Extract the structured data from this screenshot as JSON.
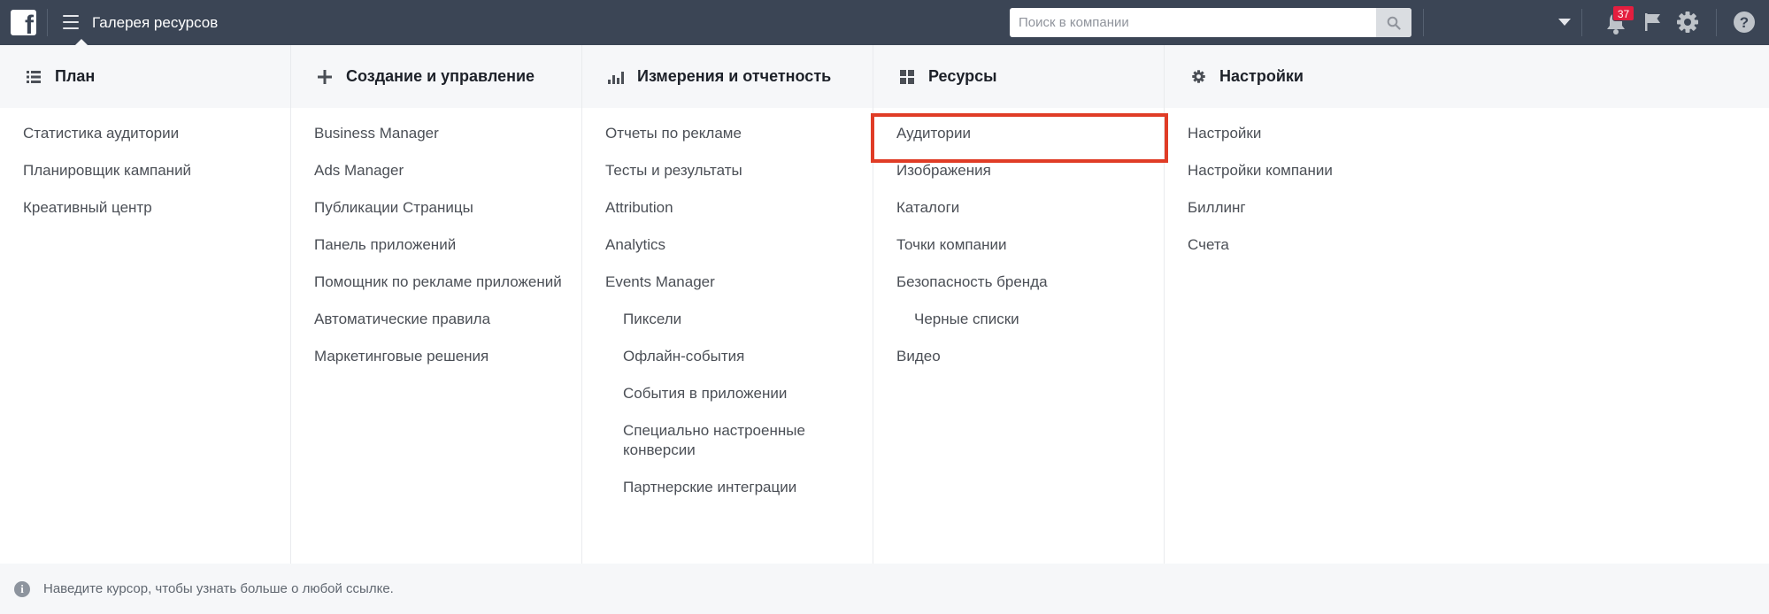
{
  "topbar": {
    "logo": "f",
    "title": "Галерея ресурсов",
    "search_placeholder": "Поиск в компании",
    "notifications_count": "37",
    "colors": {
      "bar": "#3b4555",
      "badge": "#e41e3f"
    }
  },
  "columns": [
    {
      "icon": "list-icon",
      "title": "План",
      "items": [
        {
          "label": "Статистика аудитории",
          "sub": false
        },
        {
          "label": "Планировщик кампаний",
          "sub": false
        },
        {
          "label": "Креативный центр",
          "sub": false
        }
      ]
    },
    {
      "icon": "plus-icon",
      "title": "Создание и управление",
      "items": [
        {
          "label": "Business Manager",
          "sub": false
        },
        {
          "label": "Ads Manager",
          "sub": false
        },
        {
          "label": "Публикации Страницы",
          "sub": false
        },
        {
          "label": "Панель приложений",
          "sub": false
        },
        {
          "label": "Помощник по рекламе приложений",
          "sub": false
        },
        {
          "label": "Автоматические правила",
          "sub": false
        },
        {
          "label": "Маркетинговые решения",
          "sub": false
        }
      ]
    },
    {
      "icon": "bar-chart-icon",
      "title": "Измерения и отчетность",
      "items": [
        {
          "label": "Отчеты по рекламе",
          "sub": false
        },
        {
          "label": "Тесты и результаты",
          "sub": false
        },
        {
          "label": "Attribution",
          "sub": false
        },
        {
          "label": "Analytics",
          "sub": false
        },
        {
          "label": "Events Manager",
          "sub": false
        },
        {
          "label": "Пиксели",
          "sub": true
        },
        {
          "label": "Офлайн-события",
          "sub": true
        },
        {
          "label": "События в приложении",
          "sub": true
        },
        {
          "label": "Специально настроенные конверсии",
          "sub": true
        },
        {
          "label": "Партнерские интеграции",
          "sub": true
        }
      ]
    },
    {
      "icon": "grid-icon",
      "title": "Ресурсы",
      "items": [
        {
          "label": "Аудитории",
          "sub": false
        },
        {
          "label": "Изображения",
          "sub": false
        },
        {
          "label": "Каталоги",
          "sub": false
        },
        {
          "label": "Точки компании",
          "sub": false
        },
        {
          "label": "Безопасность бренда",
          "sub": false
        },
        {
          "label": "Черные списки",
          "sub": true
        },
        {
          "label": "Видео",
          "sub": false
        }
      ]
    },
    {
      "icon": "gear-icon",
      "title": "Настройки",
      "items": [
        {
          "label": "Настройки",
          "sub": false
        },
        {
          "label": "Настройки компании",
          "sub": false
        },
        {
          "label": "Биллинг",
          "sub": false
        },
        {
          "label": "Счета",
          "sub": false
        }
      ]
    }
  ],
  "highlight": {
    "color": "#e03c26",
    "target": "Аудитории"
  },
  "footer": {
    "text": "Наведите курсор, чтобы узнать больше о любой ссылке."
  }
}
